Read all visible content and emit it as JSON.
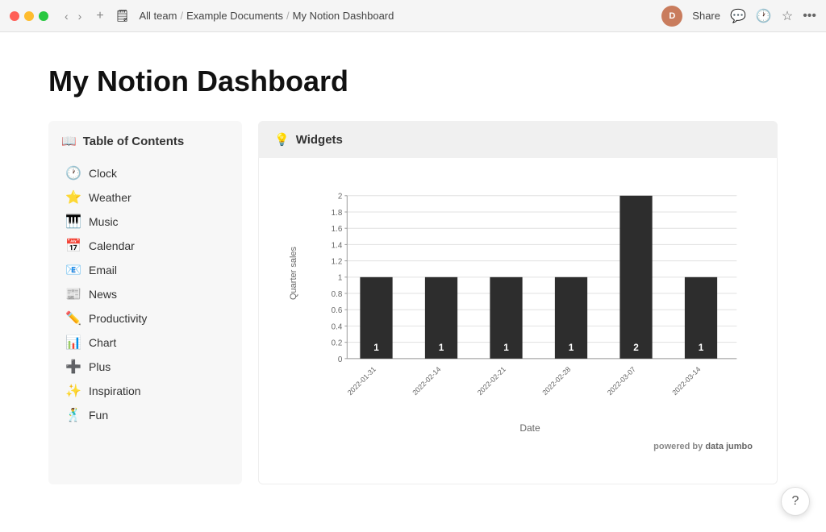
{
  "titlebar": {
    "breadcrumb": [
      "All team",
      "Example Documents",
      "My Notion Dashboard"
    ],
    "share_label": "Share",
    "avatar_initials": "D"
  },
  "page": {
    "title": "My Notion Dashboard"
  },
  "toc": {
    "header": "Table of Contents",
    "header_icon": "📖",
    "items": [
      {
        "icon": "🕐",
        "label": "Clock"
      },
      {
        "icon": "⭐",
        "label": "Weather"
      },
      {
        "icon": "🎹",
        "label": "Music"
      },
      {
        "icon": "📅",
        "label": "Calendar"
      },
      {
        "icon": "📧",
        "label": "Email"
      },
      {
        "icon": "📰",
        "label": "News"
      },
      {
        "icon": "✏️",
        "label": "Productivity"
      },
      {
        "icon": "📊",
        "label": "Chart"
      },
      {
        "icon": "➕",
        "label": "Plus"
      },
      {
        "icon": "✨",
        "label": "Inspiration"
      },
      {
        "icon": "🕺",
        "label": "Fun"
      }
    ]
  },
  "widgets": {
    "header": "Widgets",
    "header_icon": "💡",
    "chart": {
      "y_axis_label": "Quarter sales",
      "x_axis_label": "Date",
      "bars": [
        {
          "date": "2022-01-31",
          "value": 1
        },
        {
          "date": "2022-02-14",
          "value": 1
        },
        {
          "date": "2022-02-21",
          "value": 1
        },
        {
          "date": "2022-02-28",
          "value": 1
        },
        {
          "date": "2022-03-07",
          "value": 2
        },
        {
          "date": "2022-03-14",
          "value": 1
        }
      ],
      "y_max": 2,
      "y_ticks": [
        0,
        0.2,
        0.4,
        0.6,
        0.8,
        1.0,
        1.2,
        1.4,
        1.6,
        1.8,
        2.0
      ]
    },
    "powered_by": "powered by",
    "powered_by_brand": "data jumbo"
  },
  "help": {
    "label": "?"
  }
}
